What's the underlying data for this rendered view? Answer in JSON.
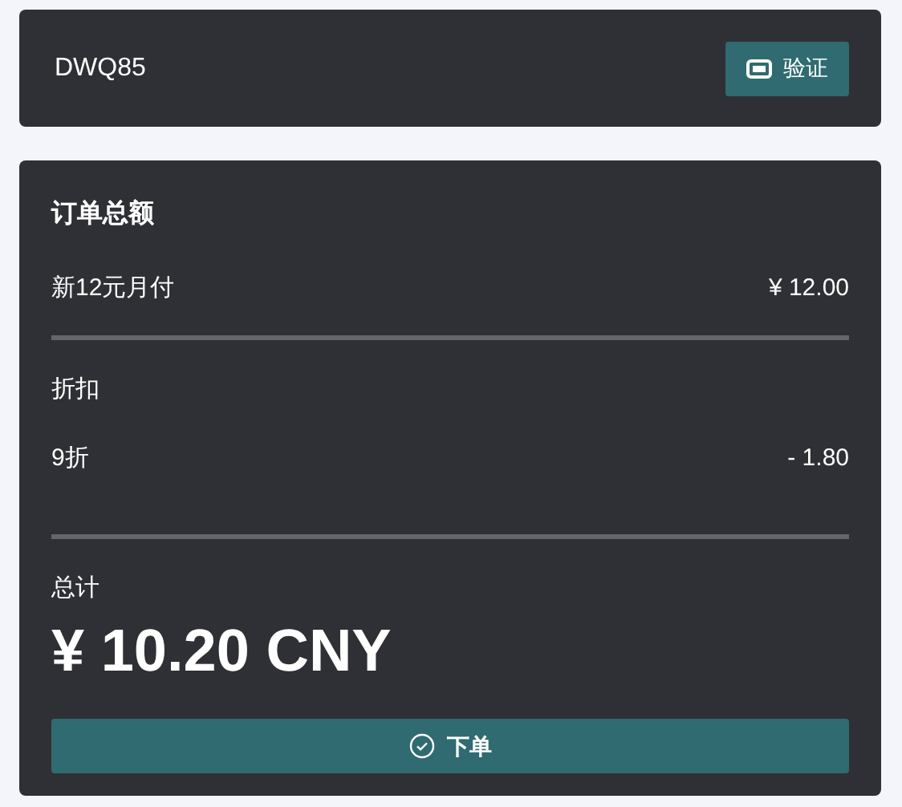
{
  "coupon": {
    "code": "DWQ85",
    "button": "验证"
  },
  "summary": {
    "title": "订单总额",
    "items": [
      {
        "name": "新12元月付",
        "amount": "¥ 12.00"
      }
    ],
    "discount_heading": "折扣",
    "discounts": [
      {
        "name": "9折",
        "amount": "- 1.80"
      }
    ],
    "total_label": "总计",
    "total": "¥ 10.20 CNY",
    "submit": "下单"
  }
}
